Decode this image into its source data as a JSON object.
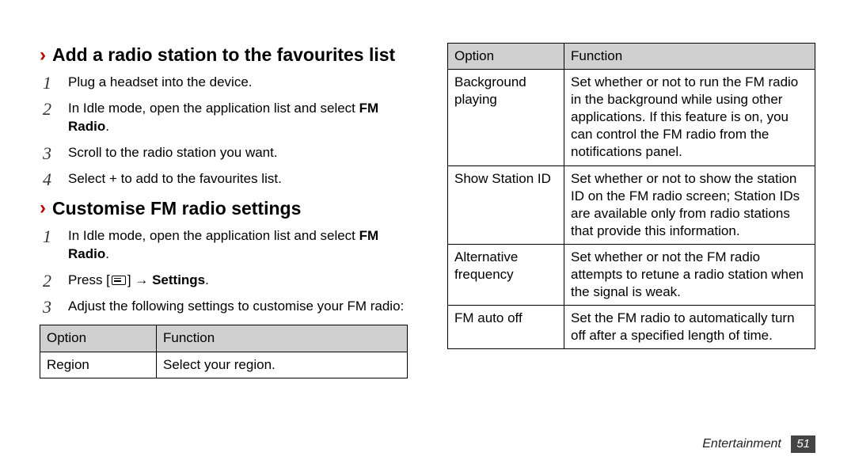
{
  "section1": {
    "title": "Add a radio station to the favourites list",
    "steps": [
      {
        "pre": "Plug a headset into the device.",
        "bold": "",
        "post": ""
      },
      {
        "pre": "In Idle mode, open the application list and select ",
        "bold": "FM Radio",
        "post": "."
      },
      {
        "pre": "Scroll to the radio station you want.",
        "bold": "",
        "post": ""
      },
      {
        "pre": "Select + to add to the favourites list.",
        "bold": "",
        "post": ""
      }
    ]
  },
  "section2": {
    "title": "Customise FM radio settings",
    "steps": [
      {
        "pre": "In Idle mode, open the application list and select ",
        "bold": "FM Radio",
        "post": "."
      },
      {
        "pre": "Press [",
        "icon": true,
        "mid": "] → ",
        "bold": "Settings",
        "post": "."
      },
      {
        "pre": "Adjust the following settings to customise your FM radio:",
        "bold": "",
        "post": ""
      }
    ]
  },
  "table_header": {
    "opt": "Option",
    "func": "Function"
  },
  "table1": [
    {
      "opt": "Region",
      "func": "Select your region."
    }
  ],
  "table2": [
    {
      "opt": "Background playing",
      "func": "Set whether or not to run the FM radio in the background while using other applications. If this feature is on, you can control the FM radio from the notifications panel."
    },
    {
      "opt": "Show Station ID",
      "func": "Set whether or not to show the station ID on the FM radio screen; Station IDs are available only from radio stations that provide this information."
    },
    {
      "opt": "Alternative frequency",
      "func": "Set whether or not the FM radio attempts to retune a radio station when the signal is weak."
    },
    {
      "opt": "FM auto off",
      "func": "Set the FM radio to automatically turn off after a specified length of time."
    }
  ],
  "footer": {
    "section": "Entertainment",
    "page": "51"
  }
}
